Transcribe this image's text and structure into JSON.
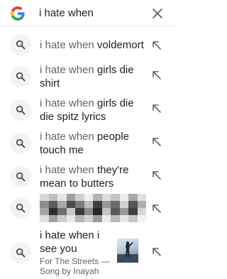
{
  "search": {
    "query": "i hate when"
  },
  "suggestions": [
    {
      "prefix": "i hate when",
      "suffix": " voldemort"
    },
    {
      "prefix": "i hate when",
      "suffix": " girls die shirt"
    },
    {
      "prefix": "i hate when",
      "suffix": " girls die die spitz lyrics"
    },
    {
      "prefix": "i hate when",
      "suffix": " people touch me"
    },
    {
      "prefix": "i hate when",
      "suffix": " they're mean to butters"
    }
  ],
  "song": {
    "title": "i hate when i see you",
    "artist": "For The Streets",
    "type_label": "Song by Inayah"
  },
  "colors": {
    "google_blue": "#4285F4",
    "google_red": "#EA4335",
    "google_yellow": "#FBBC05",
    "google_green": "#34A853"
  }
}
